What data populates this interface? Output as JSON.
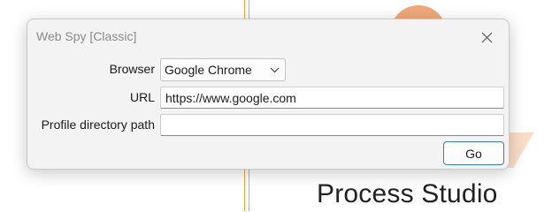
{
  "background": {
    "product_name": "Process Studio",
    "accent_color": "#e8a550"
  },
  "dialog": {
    "title": "Web Spy [Classic]",
    "close_icon": "close-icon",
    "fields": {
      "browser": {
        "label": "Browser",
        "value": "Google Chrome"
      },
      "url": {
        "label": "URL",
        "value": "https://www.google.com"
      },
      "profile": {
        "label": "Profile directory path",
        "value": ""
      }
    },
    "go_label": "Go",
    "go_border_color": "#3a79c4"
  }
}
